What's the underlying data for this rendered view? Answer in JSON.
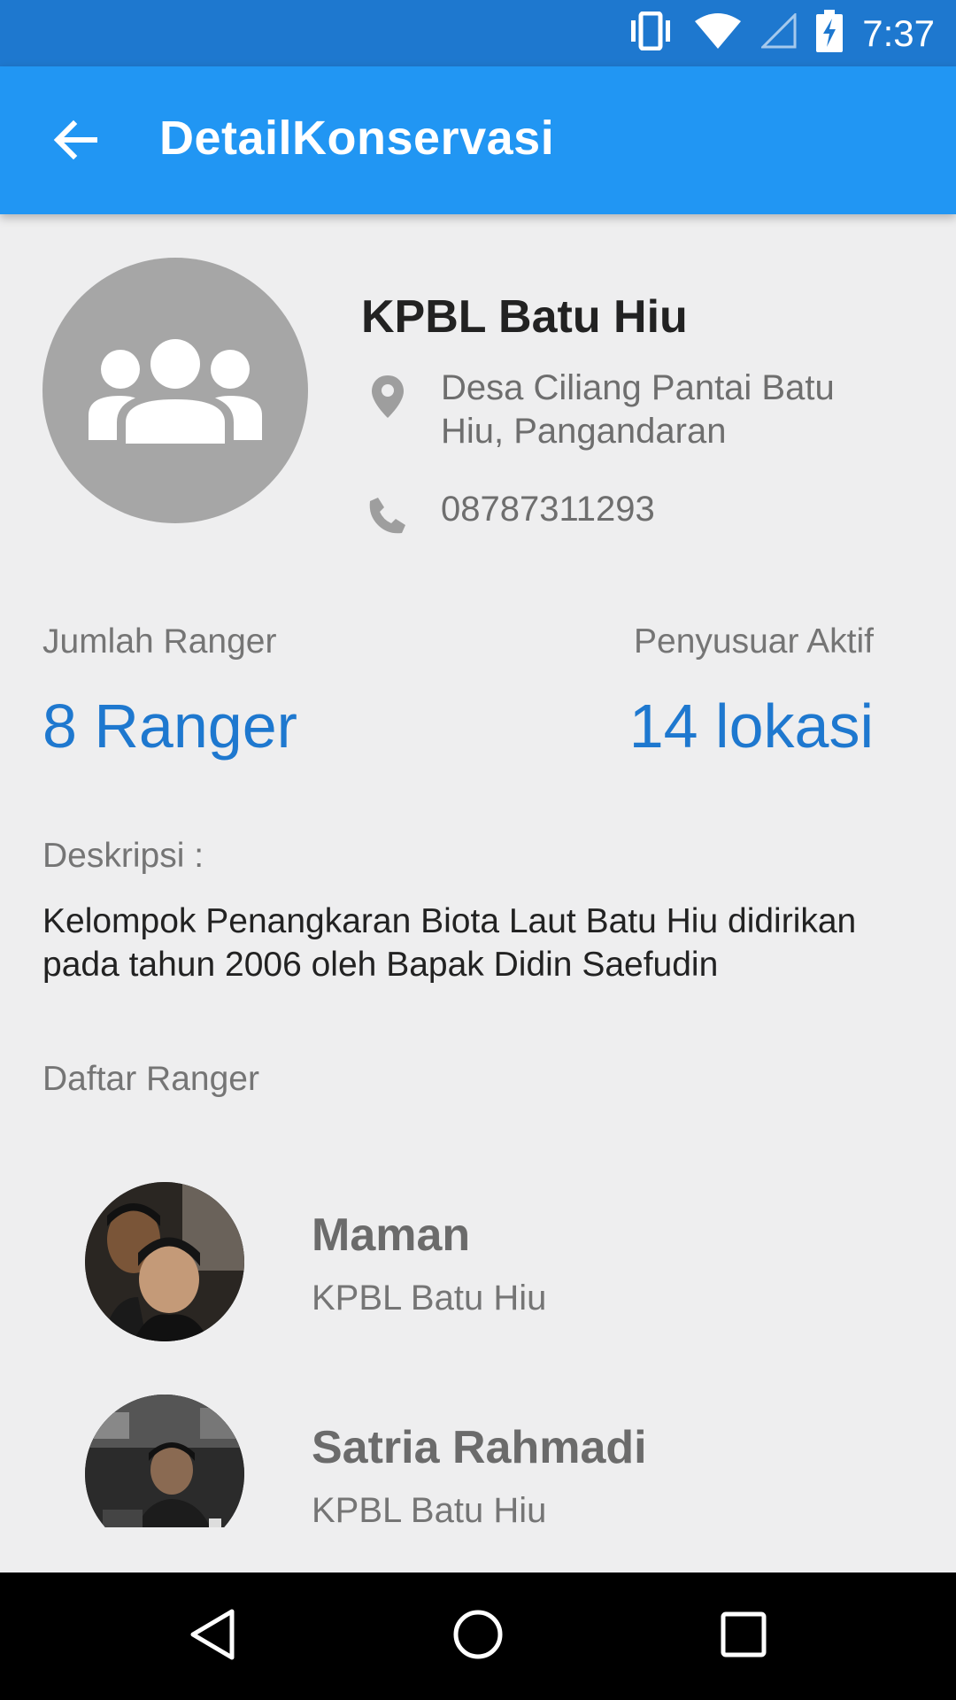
{
  "status_bar": {
    "time": "7:37",
    "icons": [
      "vibrate-icon",
      "wifi-icon",
      "cell-signal-icon",
      "battery-charging-icon"
    ]
  },
  "app_bar": {
    "back_icon": "arrow-back-icon",
    "title": "DetailKonservasi"
  },
  "profile": {
    "avatar_icon": "group-icon",
    "name": "KPBL Batu Hiu",
    "address_icon": "location-pin-icon",
    "address_line1": "Desa Ciliang Pantai Batu",
    "address_line2": "Hiu, Pangandaran",
    "phone_icon": "phone-icon",
    "phone": "08787311293"
  },
  "stats": {
    "rangers_label": "Jumlah Ranger",
    "rangers_value": "8 Ranger",
    "active_label": "Penyusuar Aktif",
    "active_value": "14 lokasi"
  },
  "description": {
    "label": "Deskripsi :",
    "line1": "Kelompok Penangkaran Biota Laut Batu Hiu didirikan",
    "line2": "pada tahun 2006 oleh Bapak Didin Saefudin"
  },
  "ranger_list": {
    "label": "Daftar Ranger",
    "items": [
      {
        "name": "Maman",
        "org": "KPBL Batu Hiu"
      },
      {
        "name": "Satria Rahmadi",
        "org": "KPBL Batu Hiu"
      }
    ]
  },
  "nav_bar": {
    "back": "nav-back-icon",
    "home": "nav-home-icon",
    "recents": "nav-recents-icon"
  },
  "colors": {
    "status_bar": "#1E78CF",
    "app_bar": "#2196F3",
    "accent": "#1E78CF",
    "background": "#EEEEEF"
  }
}
